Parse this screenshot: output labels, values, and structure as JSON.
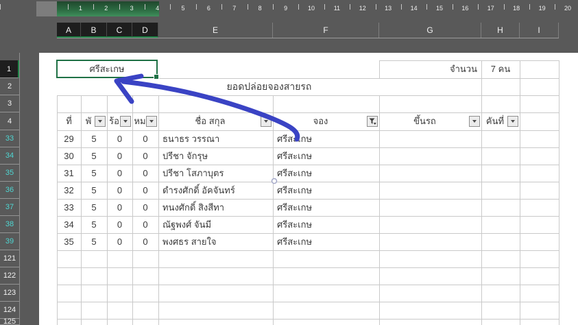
{
  "ruler": {
    "numbers": [
      "1",
      "2",
      "3",
      "4",
      "5",
      "6",
      "7",
      "8",
      "9",
      "10",
      "11",
      "12",
      "13",
      "14",
      "15",
      "16",
      "17",
      "18",
      "19",
      "20"
    ]
  },
  "columns": [
    {
      "label": "A",
      "selected": true
    },
    {
      "label": "B",
      "selected": true
    },
    {
      "label": "C",
      "selected": true
    },
    {
      "label": "D",
      "selected": true
    },
    {
      "label": "E",
      "selected": false
    },
    {
      "label": "F",
      "selected": false
    },
    {
      "label": "G",
      "selected": false
    },
    {
      "label": "H",
      "selected": false
    },
    {
      "label": "I",
      "selected": false
    }
  ],
  "row_headers": [
    {
      "label": "1",
      "state": "selected"
    },
    {
      "label": "2",
      "state": "normal"
    },
    {
      "label": "3",
      "state": "normal"
    },
    {
      "label": "4",
      "state": "normal"
    },
    {
      "label": "33",
      "state": "filtered"
    },
    {
      "label": "34",
      "state": "filtered"
    },
    {
      "label": "35",
      "state": "filtered"
    },
    {
      "label": "36",
      "state": "filtered"
    },
    {
      "label": "37",
      "state": "filtered"
    },
    {
      "label": "38",
      "state": "filtered"
    },
    {
      "label": "39",
      "state": "filtered"
    },
    {
      "label": "121",
      "state": "normal"
    },
    {
      "label": "122",
      "state": "normal"
    },
    {
      "label": "123",
      "state": "normal"
    },
    {
      "label": "124",
      "state": "normal"
    },
    {
      "label": "125",
      "state": "normal"
    }
  ],
  "cells": {
    "a1_value": "ศรีสะเกษ",
    "title": "ยอดปล่อยจองสายรถ",
    "count_label": "จำนวน",
    "count_value": "7 คน"
  },
  "table": {
    "headers": [
      {
        "label": "ที่",
        "filter": "none"
      },
      {
        "label": "พั",
        "filter": "dropdown"
      },
      {
        "label": "ร้อ",
        "filter": "dropdown"
      },
      {
        "label": "หม",
        "filter": "dropdown"
      },
      {
        "label": "ชื่อ สกุล",
        "filter": "dropdown"
      },
      {
        "label": "จอง",
        "filter": "active"
      },
      {
        "label": "ขึ้นรถ",
        "filter": "dropdown"
      },
      {
        "label": "คันที่",
        "filter": "dropdown"
      }
    ],
    "rows": [
      {
        "no": "29",
        "b": "5",
        "c": "0",
        "d": "0",
        "name": "ธนาธร  วรรณา",
        "booking": "ศรีสะเกษ"
      },
      {
        "no": "30",
        "b": "5",
        "c": "0",
        "d": "0",
        "name": "ปรีชา  จักรุษ",
        "booking": "ศรีสะเกษ"
      },
      {
        "no": "31",
        "b": "5",
        "c": "0",
        "d": "0",
        "name": "ปรีชา  โสภาบุตร",
        "booking": "ศรีสะเกษ"
      },
      {
        "no": "32",
        "b": "5",
        "c": "0",
        "d": "0",
        "name": "ดำรงศักดิ์  อัคจันทร์",
        "booking": "ศรีสะเกษ"
      },
      {
        "no": "33",
        "b": "5",
        "c": "0",
        "d": "0",
        "name": "ทนงศักดิ์  สิงสีทา",
        "booking": "ศรีสะเกษ"
      },
      {
        "no": "34",
        "b": "5",
        "c": "0",
        "d": "0",
        "name": "ณัฐพงศ์  จันมี",
        "booking": "ศรีสะเกษ"
      },
      {
        "no": "35",
        "b": "5",
        "c": "0",
        "d": "0",
        "name": "พงศธร  สายใจ",
        "booking": "ศรีสะเกษ"
      }
    ]
  },
  "colors": {
    "accent_green": "#1f7145",
    "arrow_blue": "#3a43c4",
    "filtered_row_number": "#4fd6d2",
    "app_background": "#595959"
  },
  "icons": {
    "dropdown": "chevron-down-icon",
    "active_filter": "funnel-icon"
  }
}
